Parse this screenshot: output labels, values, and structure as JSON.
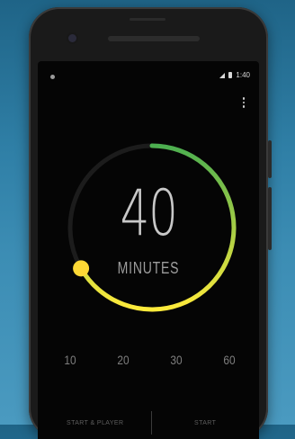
{
  "status_bar": {
    "time": "1:40"
  },
  "timer": {
    "value": "40",
    "unit": "MINUTES",
    "max_minutes": 60,
    "progress_fraction": 0.667,
    "gradient_start": "#4caf50",
    "gradient_end": "#ffeb3b",
    "knob_color": "#fdd835",
    "track_color": "#1c1c1c"
  },
  "presets": [
    "10",
    "20",
    "30",
    "60"
  ],
  "actions": {
    "start_player_label": "START & PLAYER",
    "start_label": "START"
  },
  "colors": {
    "background": "#2f7fa6",
    "screen": "#050505"
  }
}
